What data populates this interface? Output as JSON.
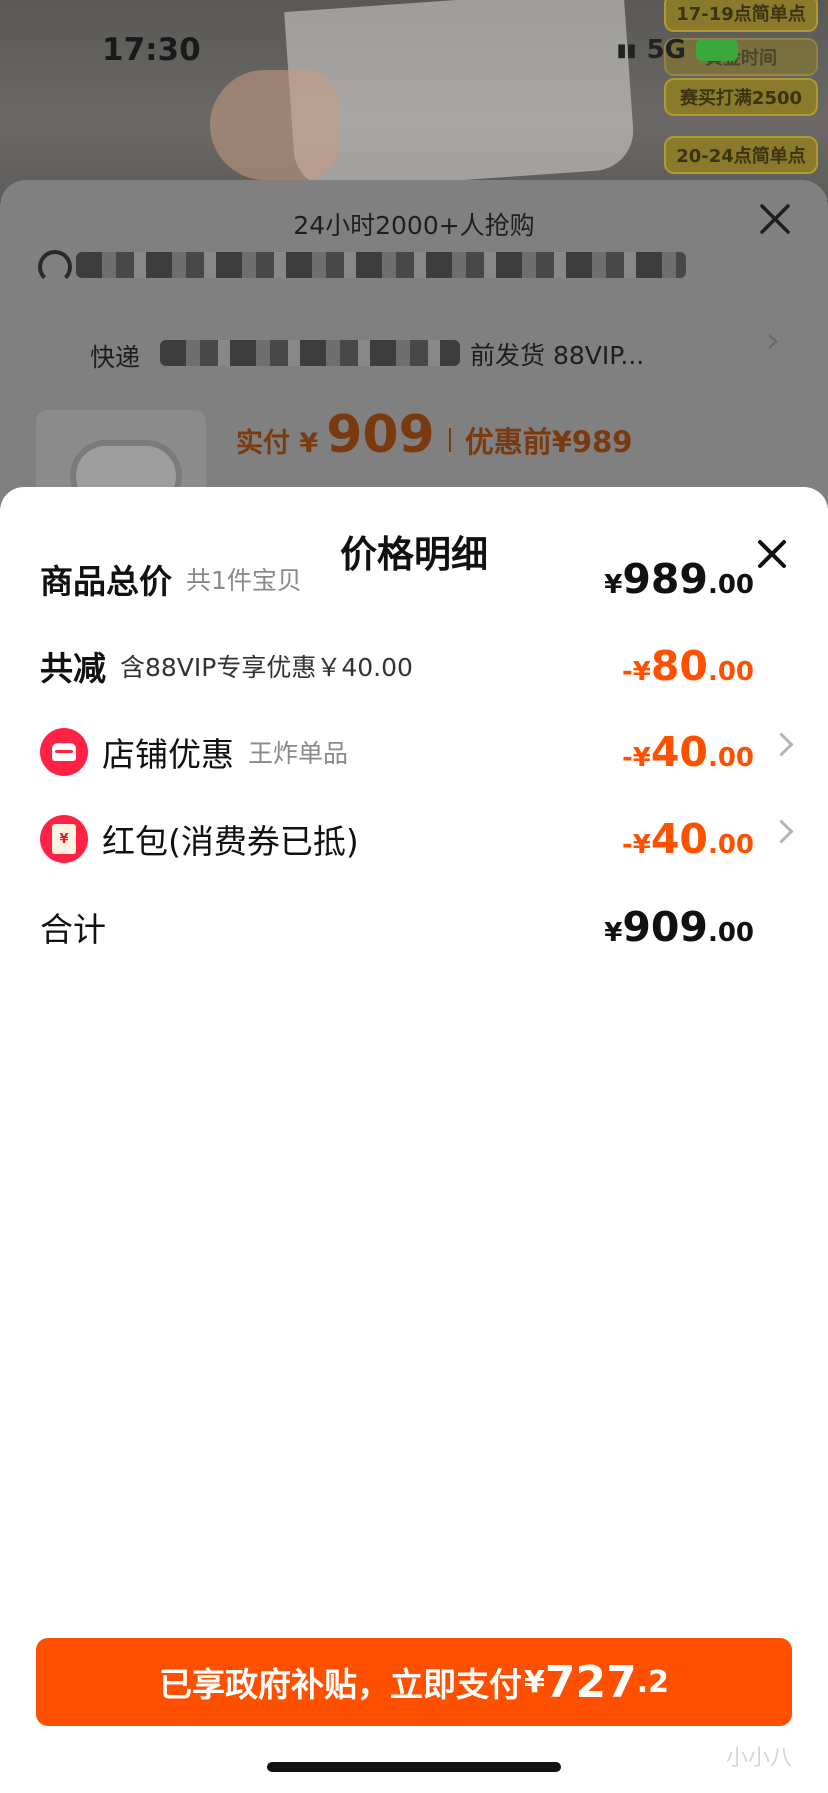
{
  "status_bar": {
    "time": "17:30",
    "network": "5G"
  },
  "background": {
    "promo_tags": [
      "17-19点简单点",
      "黄金时间",
      "赛买打满2500",
      "20-24点简单点"
    ],
    "sheet": {
      "title": "24小时2000+人抢购",
      "express_prefix": "快递",
      "ship_text": "前发货 88VIP...",
      "paid_label": "实付 ¥",
      "paid_amount": "909",
      "orig_price": "优惠前¥989"
    }
  },
  "detail": {
    "title": "价格明细",
    "rows": [
      {
        "label": "商品总价",
        "sub": "共1件宝贝",
        "sign": "¥",
        "int": "989",
        "dec": ".00"
      },
      {
        "label": "共减",
        "sub": "含88VIP专享优惠￥40.00",
        "sign": "-¥",
        "int": "80",
        "dec": ".00"
      },
      {
        "label": "店铺优惠",
        "sub": "王炸单品",
        "sign": "-¥",
        "int": "40",
        "dec": ".00"
      },
      {
        "label": "红包(消费券已抵)",
        "sub": "",
        "sign": "-¥",
        "int": "40",
        "dec": ".00"
      },
      {
        "label": "合计",
        "sub": "",
        "sign": "¥",
        "int": "909",
        "dec": ".00"
      }
    ],
    "pay_button": {
      "label": "已享政府补贴，立即支付",
      "sign": "¥",
      "int": "727",
      "dec": ".2"
    },
    "watermark": "小小八"
  },
  "colors": {
    "accent": "#ff5000",
    "icon_red": "#ff2244"
  },
  "icons": [
    "close-icon",
    "store-icon",
    "red-packet-icon",
    "chevron-right-icon"
  ]
}
